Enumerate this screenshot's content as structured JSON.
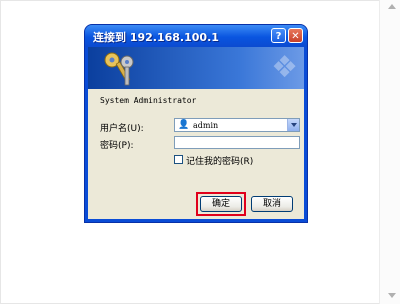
{
  "dialog": {
    "title": "连接到 192.168.100.1",
    "help_button": "?",
    "close_button": "✕",
    "banner_icon": "keys-icon",
    "message": "System Administrator",
    "username_label": "用户名(U):",
    "username_value": "admin",
    "user_icon": "user-icon",
    "password_label": "密码(P):",
    "password_value": "",
    "remember_label": "记住我的密码(R)",
    "remember_checked": false,
    "ok_label": "确定",
    "cancel_label": "取消"
  },
  "colors": {
    "titlebar": "#0a55e0",
    "body": "#ece9d8",
    "highlight": "#e0001b"
  }
}
